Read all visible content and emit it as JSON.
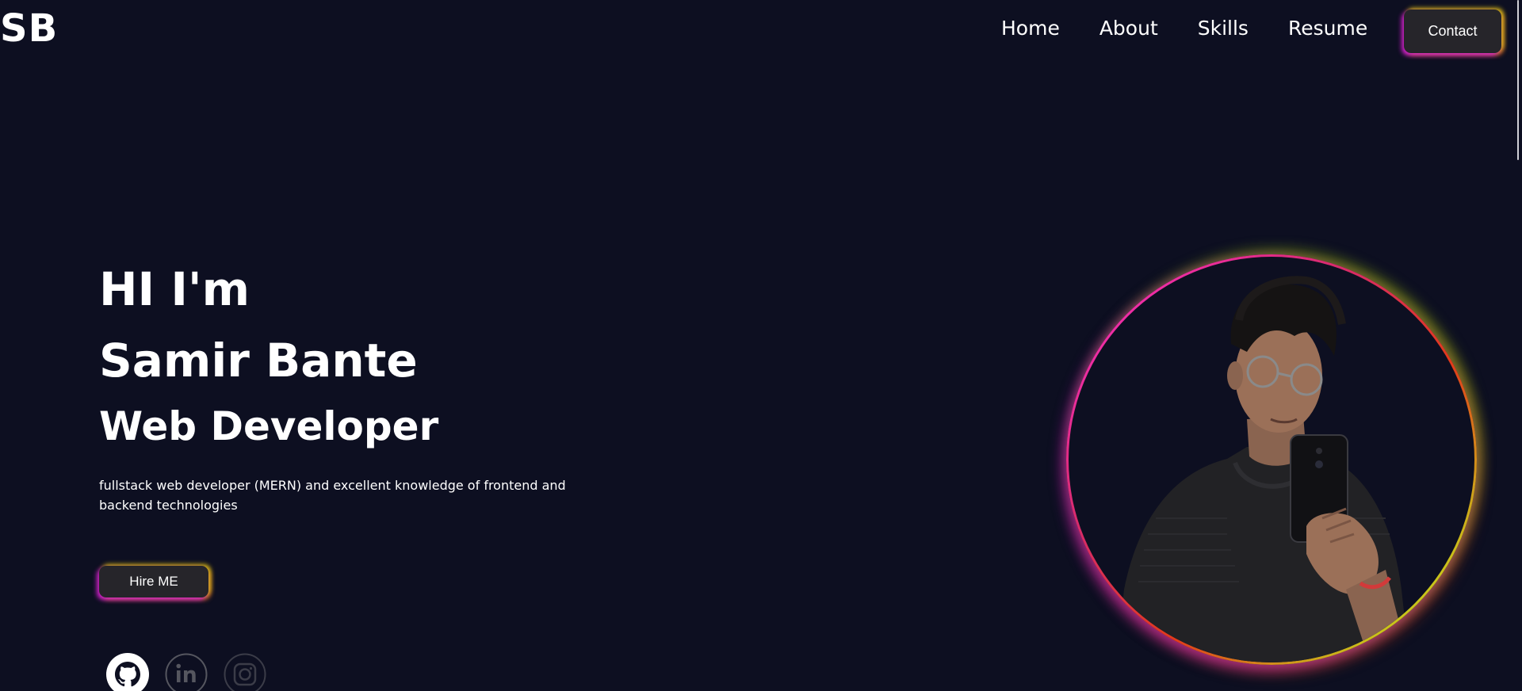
{
  "header": {
    "logo": "SB",
    "nav": [
      {
        "label": "Home"
      },
      {
        "label": "About"
      },
      {
        "label": "Skills"
      },
      {
        "label": "Resume"
      }
    ],
    "contact_label": "Contact"
  },
  "hero": {
    "greeting": "HI I'm",
    "name": "Samir Bante",
    "role": "Web Developer",
    "description": "fullstack web developer (MERN) and excellent knowledge of frontend and backend technologies",
    "hire_label": "Hire ME"
  },
  "socials": [
    {
      "icon": "github-icon"
    },
    {
      "icon": "linkedin-icon"
    },
    {
      "icon": "instagram-icon"
    }
  ],
  "profile": {
    "photo": "profile-photo"
  },
  "colors": {
    "background": "#0d0f21",
    "button_bg": "#26252a",
    "glow_magenta": "#e01ee0",
    "glow_yellow": "#e6c814",
    "glow_orange": "#e66e28",
    "text": "#ffffff"
  }
}
